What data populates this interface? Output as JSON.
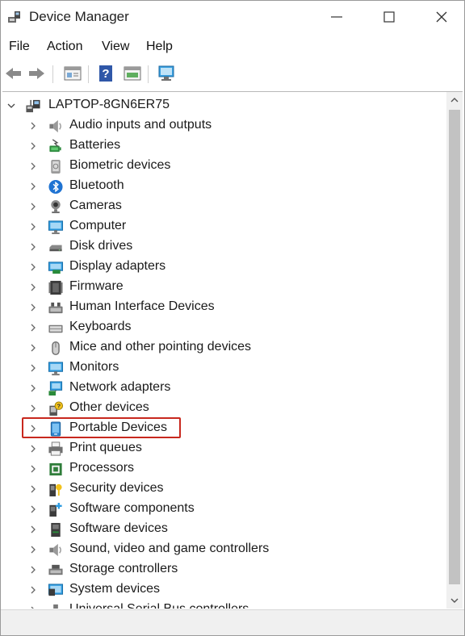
{
  "window": {
    "title": "Device Manager"
  },
  "menu": [
    {
      "label": "File"
    },
    {
      "label": "Action"
    },
    {
      "label": "View"
    },
    {
      "label": "Help"
    }
  ],
  "tree": {
    "root": {
      "label": "LAPTOP-8GN6ER75",
      "icon": "computer-icon"
    },
    "items": [
      {
        "label": "Audio inputs and outputs",
        "icon": "speaker-icon"
      },
      {
        "label": "Batteries",
        "icon": "battery-icon"
      },
      {
        "label": "Biometric devices",
        "icon": "fingerprint-icon"
      },
      {
        "label": "Bluetooth",
        "icon": "bluetooth-icon"
      },
      {
        "label": "Cameras",
        "icon": "camera-icon"
      },
      {
        "label": "Computer",
        "icon": "monitor-icon"
      },
      {
        "label": "Disk drives",
        "icon": "disk-drive-icon"
      },
      {
        "label": "Display adapters",
        "icon": "display-adapter-icon"
      },
      {
        "label": "Firmware",
        "icon": "firmware-icon"
      },
      {
        "label": "Human Interface Devices",
        "icon": "hid-icon"
      },
      {
        "label": "Keyboards",
        "icon": "keyboard-icon"
      },
      {
        "label": "Mice and other pointing devices",
        "icon": "mouse-icon"
      },
      {
        "label": "Monitors",
        "icon": "monitor-icon"
      },
      {
        "label": "Network adapters",
        "icon": "network-icon"
      },
      {
        "label": "Other devices",
        "icon": "unknown-device-icon"
      },
      {
        "label": "Portable Devices",
        "icon": "portable-device-icon"
      },
      {
        "label": "Print queues",
        "icon": "printer-icon"
      },
      {
        "label": "Processors",
        "icon": "processor-icon"
      },
      {
        "label": "Security devices",
        "icon": "security-device-icon"
      },
      {
        "label": "Software components",
        "icon": "software-component-icon"
      },
      {
        "label": "Software devices",
        "icon": "software-device-icon"
      },
      {
        "label": "Sound, video and game controllers",
        "icon": "speaker-icon"
      },
      {
        "label": "Storage controllers",
        "icon": "storage-controller-icon"
      },
      {
        "label": "System devices",
        "icon": "system-device-icon"
      },
      {
        "label": "Universal Serial Bus controllers",
        "icon": "usb-icon"
      }
    ]
  },
  "highlight": {
    "item": "Portable Devices",
    "color": "#c8281e"
  }
}
